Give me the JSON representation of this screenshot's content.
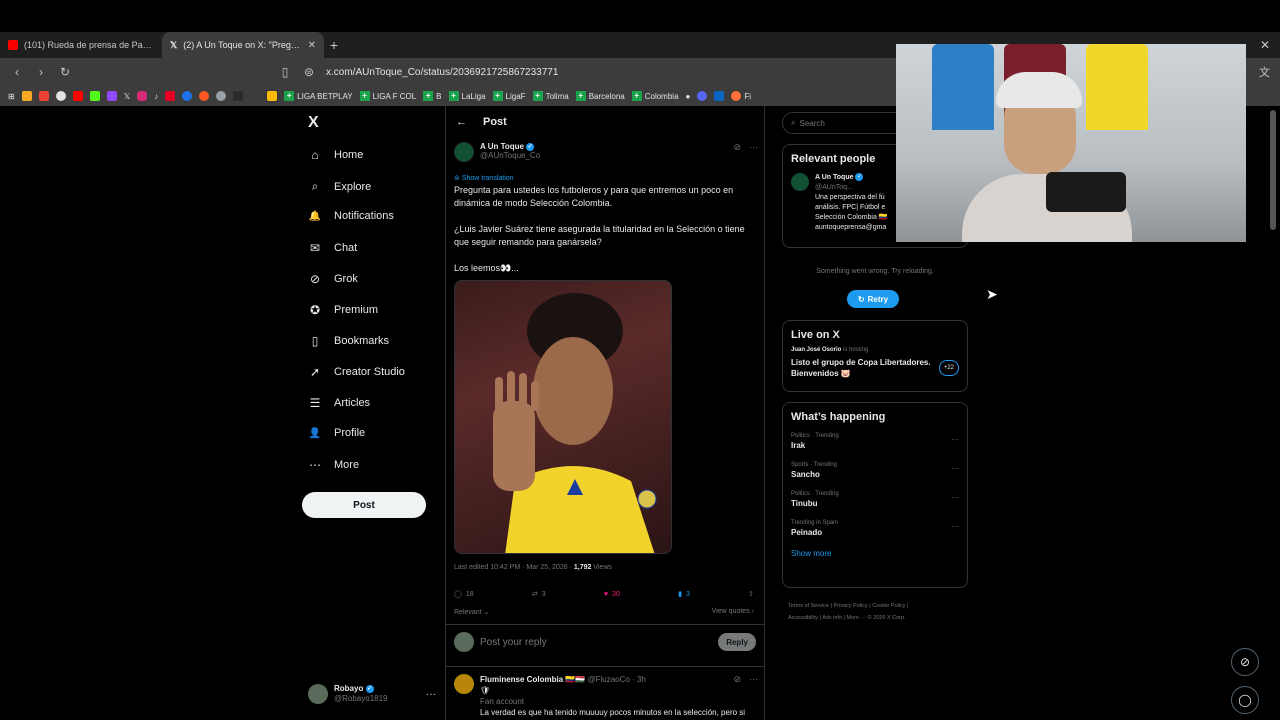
{
  "browser": {
    "tabs": [
      {
        "title": "(101) Rueda de prensa de Pasto tras",
        "icon_color": "#ff0000"
      },
      {
        "title": "(2) A Un Toque on X: \"Pregunta",
        "icon_color": "#ffffff"
      }
    ],
    "url": "x.com/AUnToque_Co/status/2036921725867233771",
    "bookmarks": [
      "LIGA BETPLAY",
      "LIGA F COL",
      "B",
      "LaLiga",
      "LigaF",
      "Tolima",
      "Barcelona",
      "Colombia",
      "Fi"
    ]
  },
  "nav": {
    "logo": "X",
    "items": [
      {
        "label": "Home",
        "icon": "home-icon",
        "glyph": "⌂"
      },
      {
        "label": "Explore",
        "icon": "search-icon",
        "glyph": "⌕"
      },
      {
        "label": "Notifications",
        "icon": "bell-icon",
        "glyph": "🔔"
      },
      {
        "label": "Chat",
        "icon": "mail-icon",
        "glyph": "✉"
      },
      {
        "label": "Grok",
        "icon": "grok-icon",
        "glyph": "⊘"
      },
      {
        "label": "Premium",
        "icon": "premium-icon",
        "glyph": "✪"
      },
      {
        "label": "Bookmarks",
        "icon": "bookmark-icon",
        "glyph": "▯"
      },
      {
        "label": "Creator Studio",
        "icon": "rocket-icon",
        "glyph": "➚"
      },
      {
        "label": "Articles",
        "icon": "articles-icon",
        "glyph": "☰"
      },
      {
        "label": "Profile",
        "icon": "person-icon",
        "glyph": "👤"
      },
      {
        "label": "More",
        "icon": "more-circle-icon",
        "glyph": "⋯"
      }
    ],
    "post_button": "Post",
    "account": {
      "name": "Robayo",
      "handle": "@Robayo1819"
    }
  },
  "main": {
    "header_title": "Post",
    "author": {
      "name": "A Un Toque",
      "handle": "@AUnToque_Co"
    },
    "show_translation": "Show translation",
    "paragraphs": [
      "Pregunta para ustedes los futboleros y para que entremos un poco en dinámica de modo Selección Colombia.",
      "¿Luis Javier Suárez tiene asegurada la titularidad en la Selección o tiene que seguir remando para ganársela?",
      "Los leemos👀..."
    ],
    "meta": {
      "edited": "Last edited 10:42 PM · Mar 25, 2026 · ",
      "views_count": "1,792",
      "views_label": " Views"
    },
    "stats": {
      "replies": "18",
      "reposts": "3",
      "likes": "30",
      "bookmarks": "3"
    },
    "relevant": "Relevant",
    "view_quotes": "View quotes",
    "reply_placeholder": "Post your reply",
    "reply_button": "Reply",
    "first_reply": {
      "name": "Fluminense Colombia 🇨🇴🇭🇺",
      "handle": "@FluzaoCo · 3h",
      "sub": "Fan account",
      "text": "La verdad es que ha tenido muuuuy pocos minutos en la selección, pero si"
    }
  },
  "right": {
    "search_placeholder": "Search",
    "relevant_title": "Relevant people",
    "relevant_person": {
      "name": "A Un Toque",
      "handle": "@AUnToq...",
      "bio": [
        "Una perspectiva del fú",
        "análisis. FPC| Fútbol e",
        "Selección Colombia 🇨🇴",
        "auntoqueprensa@gma"
      ]
    },
    "error": "Something went wrong. Try reloading.",
    "retry": "Retry",
    "live_title": "Live on X",
    "live_host_name": "Juan José Osorio",
    "live_host_suffix": " is hosting",
    "live_text": "Listo el grupo de Copa Libertadores. Bienvenidos 🐷",
    "live_count": "+22",
    "happening_title": "What’s happening",
    "trends": [
      {
        "category": "Politics · Trending",
        "name": "Irak"
      },
      {
        "category": "Sports · Trending",
        "name": "Sancho"
      },
      {
        "category": "Politics · Trending",
        "name": "Tinubu"
      },
      {
        "category": "Trending in Spain",
        "name": "Peinado"
      }
    ],
    "show_more": "Show more",
    "footer": [
      "Terms of Service",
      "Privacy Policy",
      "Cookie Policy",
      "Accessibility",
      "Ads info",
      "More ···",
      "© 2026 X Corp."
    ]
  }
}
